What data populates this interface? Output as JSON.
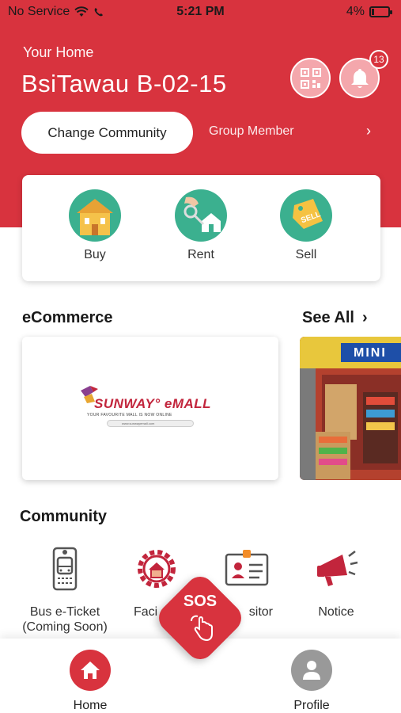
{
  "status_bar": {
    "carrier": "No Service",
    "time": "5:21 PM",
    "battery": "4%"
  },
  "header": {
    "home_label": "Your Home",
    "home_name": "BsiTawau B-02-15",
    "notification_count": "13",
    "change_community": "Change Community",
    "group_member": "Group Member"
  },
  "property": {
    "items": [
      {
        "label": "Buy"
      },
      {
        "label": "Rent"
      },
      {
        "label": "Sell"
      }
    ],
    "sell_tag": "SELL"
  },
  "ecommerce": {
    "title": "eCommerce",
    "see_all": "See All",
    "cards": [
      {
        "brand": "SUNWAY° eMALL",
        "tagline": "YOUR FAVOURITE MALL IS NOW ONLINE",
        "url": "www.sunwayemall.com"
      },
      {
        "brand": "MINI"
      }
    ]
  },
  "community": {
    "title": "Community",
    "items": [
      {
        "label": "Bus e-Ticket (Coming Soon)"
      },
      {
        "label": "Faci"
      },
      {
        "label": "sitor"
      },
      {
        "label": "Notice"
      }
    ]
  },
  "sos": {
    "label": "SOS"
  },
  "bottom_nav": {
    "home": "Home",
    "profile": "Profile"
  },
  "colors": {
    "brand_red": "#d8333e",
    "green_circle": "#3bb08f"
  }
}
